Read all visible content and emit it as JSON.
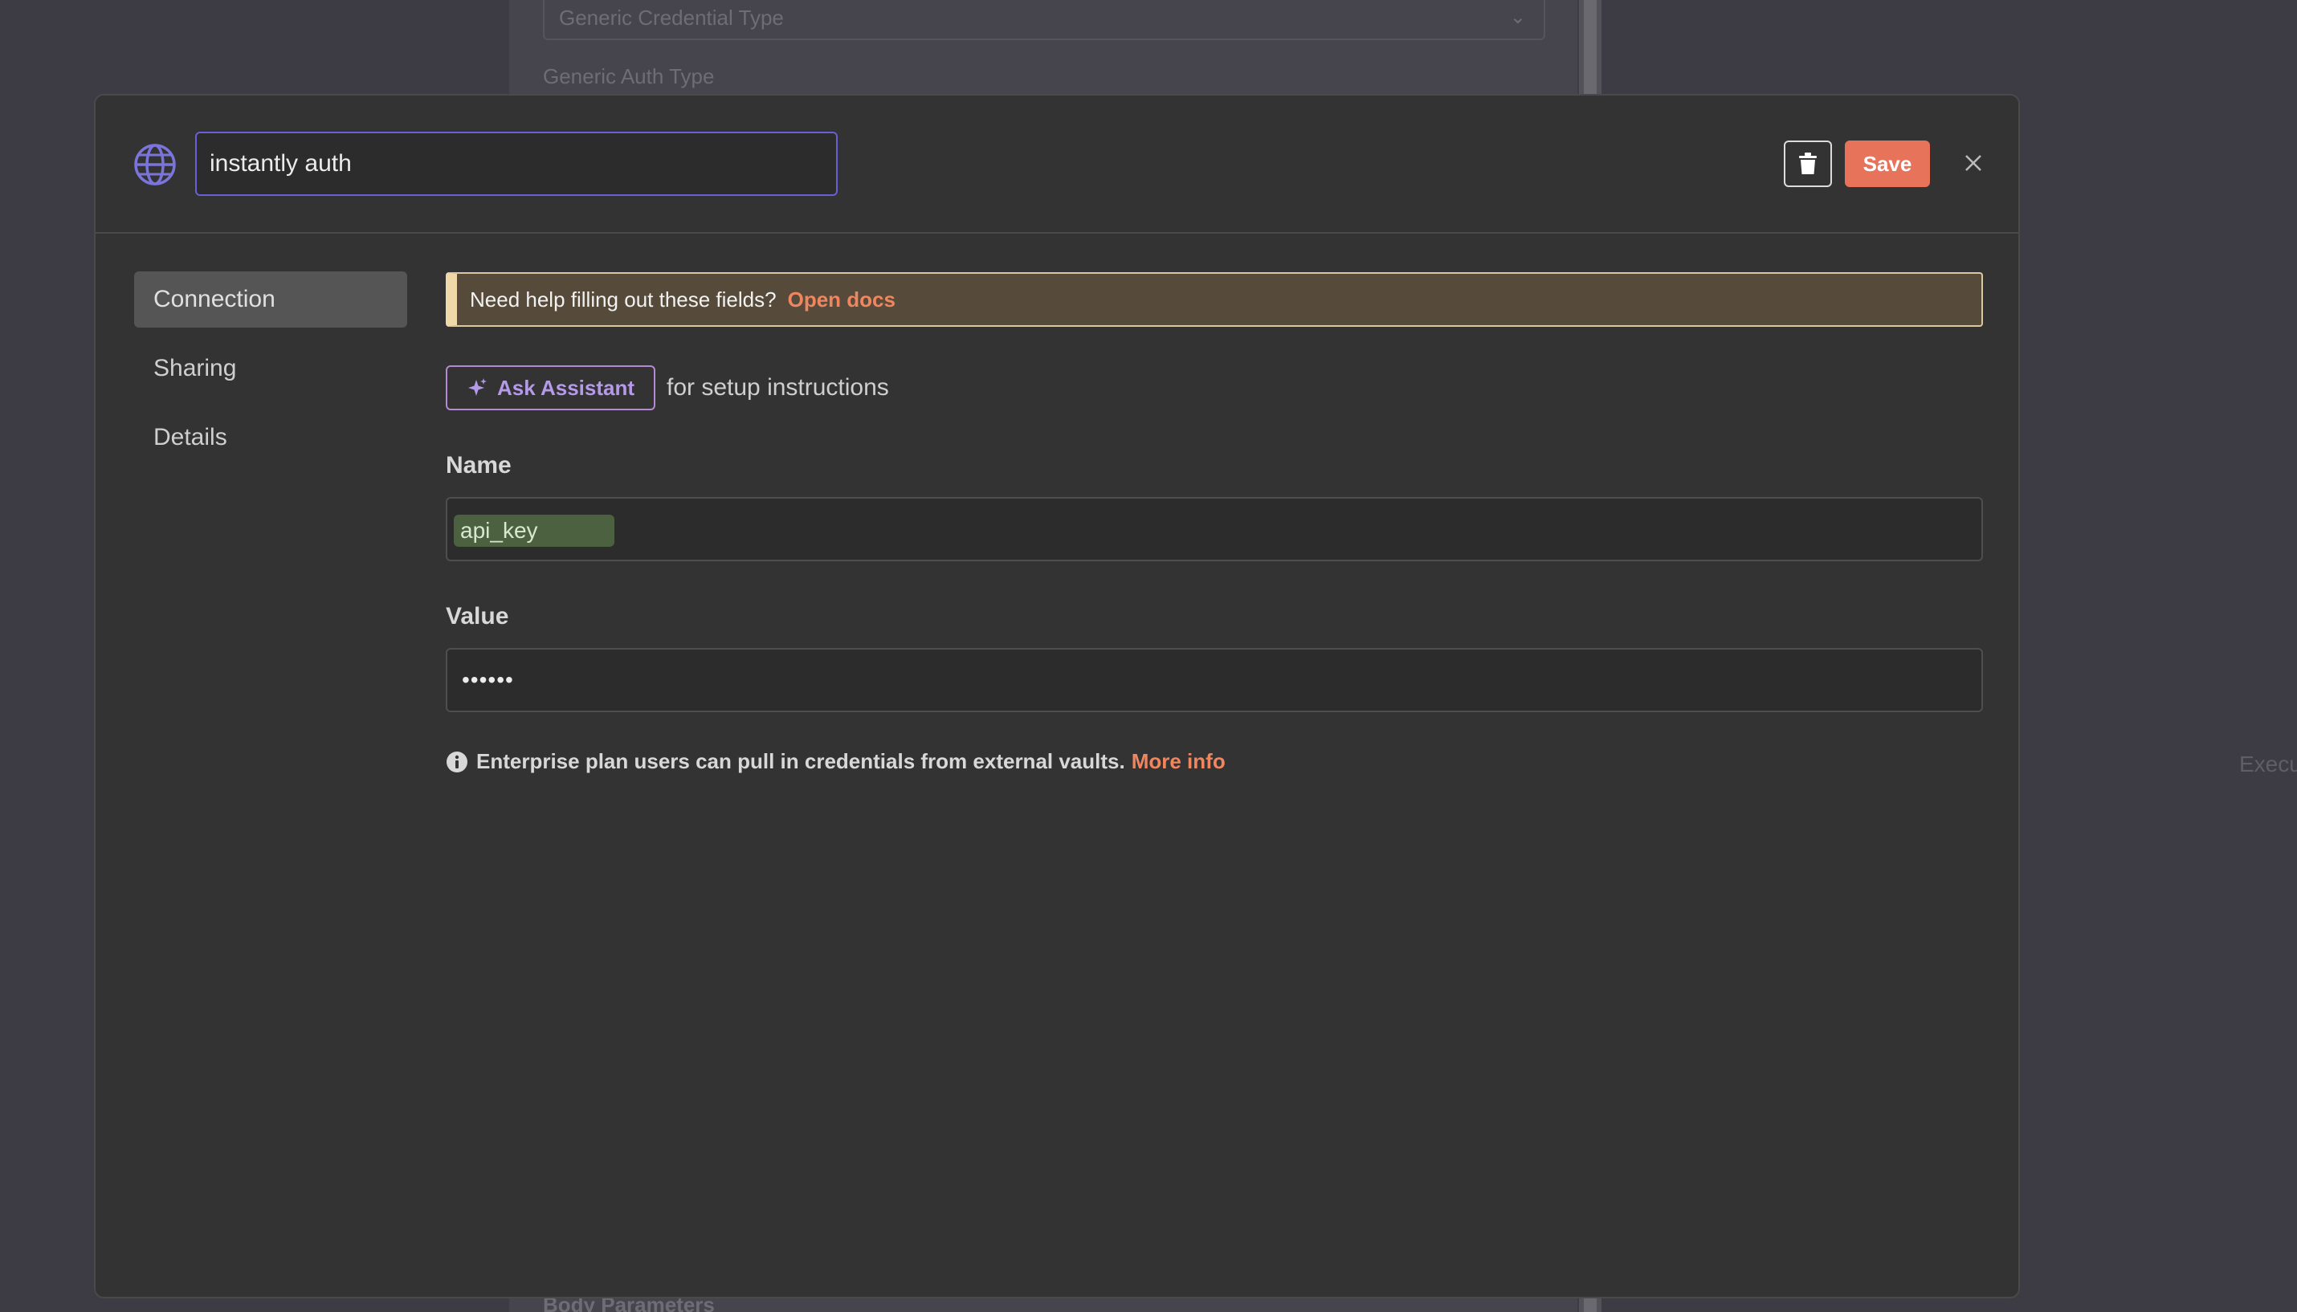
{
  "background": {
    "select_value": "Generic Credential Type",
    "auth_type_label": "Generic Auth Type",
    "bottom_label": "Body Parameters",
    "right_text": "Execu"
  },
  "modal": {
    "title_value": "instantly auth",
    "save_label": "Save",
    "icons": {
      "header": "globe-icon",
      "delete": "trash-icon",
      "close": "close-icon",
      "assistant": "sparkle-icon",
      "info": "info-icon"
    },
    "colors": {
      "accent": "#e8735b",
      "globe": "#7b74d9",
      "link": "#f0865f",
      "notice_bg": "#564b3a",
      "assistant_border": "#b48ad6"
    }
  },
  "sidebar": {
    "items": [
      {
        "label": "Connection",
        "active": true
      },
      {
        "label": "Sharing",
        "active": false
      },
      {
        "label": "Details",
        "active": false
      }
    ]
  },
  "content": {
    "notice_text": "Need help filling out these fields?",
    "notice_link": "Open docs",
    "ask_button_label": "Ask Assistant",
    "ask_suffix": "for setup instructions",
    "fields": [
      {
        "label": "Name",
        "value": "api_key"
      },
      {
        "label": "Value",
        "value": "••••••"
      }
    ],
    "info_text": "Enterprise plan users can pull in credentials from external vaults.",
    "info_link": "More info"
  }
}
